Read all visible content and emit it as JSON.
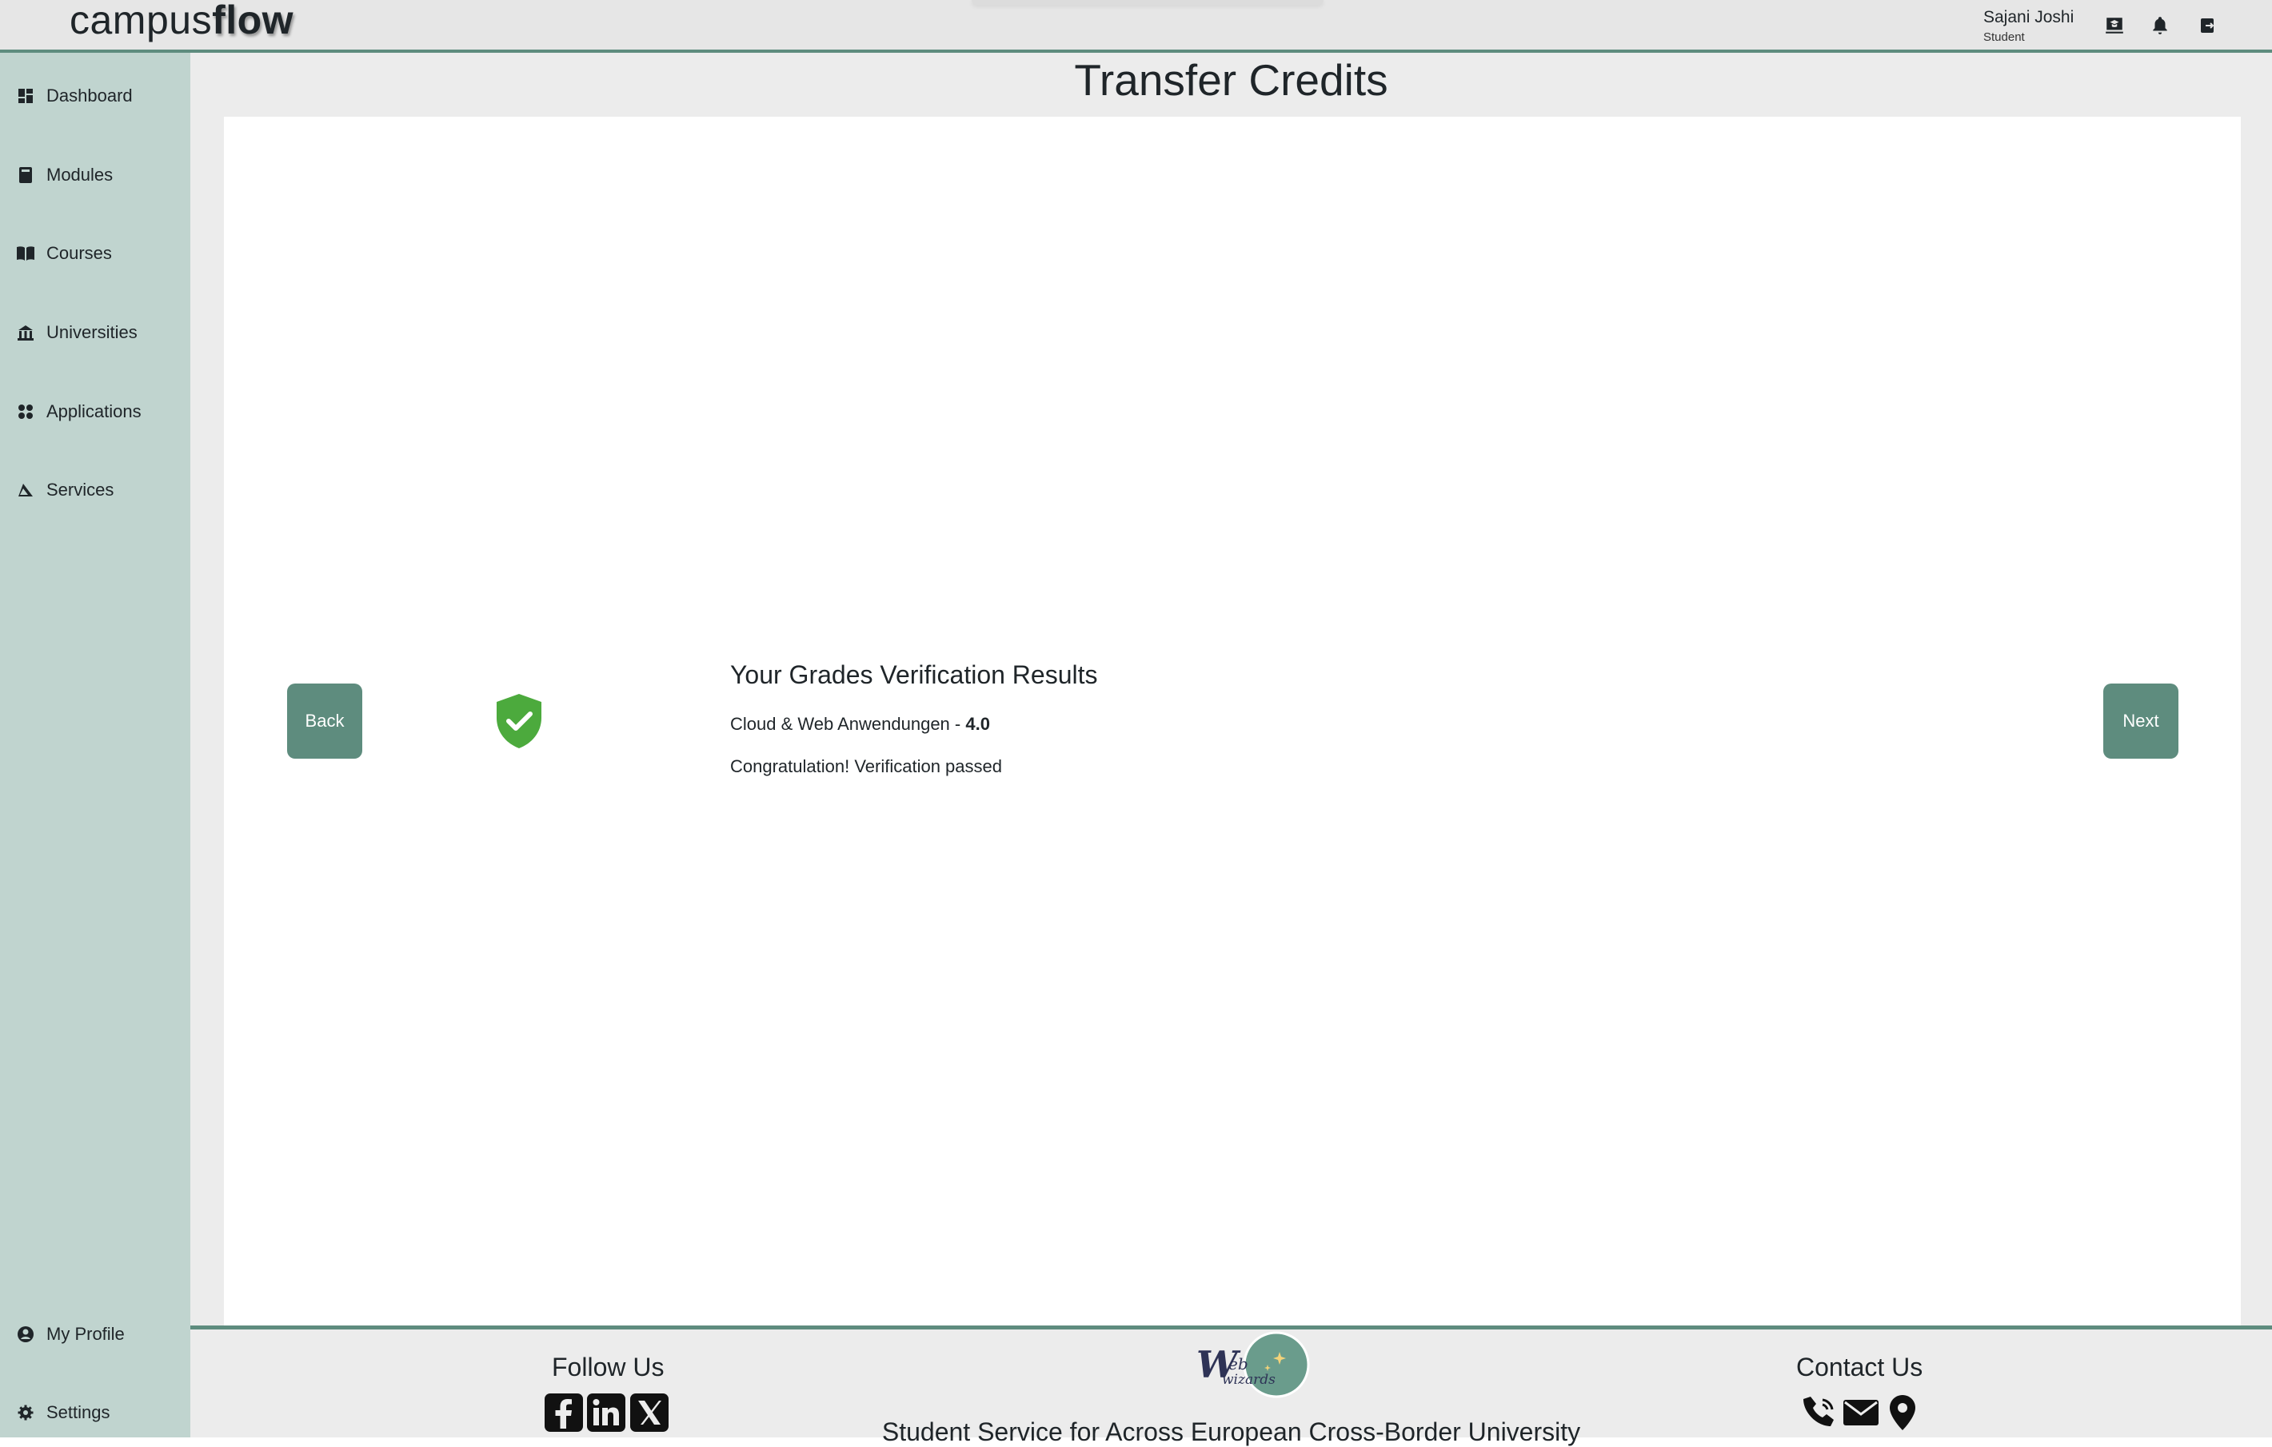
{
  "header": {
    "logo_light": "campus",
    "logo_bold": "flow",
    "user_name": "Sajani Joshi",
    "user_role": "Student",
    "icons": [
      "graduation-icon",
      "bell-icon",
      "logout-icon"
    ]
  },
  "sidebar": {
    "items": [
      {
        "label": "Dashboard",
        "icon": "dashboard-icon"
      },
      {
        "label": "Modules",
        "icon": "book-icon"
      },
      {
        "label": "Courses",
        "icon": "open-book-icon"
      },
      {
        "label": "Universities",
        "icon": "university-icon"
      },
      {
        "label": "Applications",
        "icon": "apps-icon"
      },
      {
        "label": "Services",
        "icon": "services-icon"
      }
    ],
    "bottom_items": [
      {
        "label": "My Profile",
        "icon": "profile-icon"
      },
      {
        "label": "Settings",
        "icon": "gear-icon"
      }
    ]
  },
  "main": {
    "title": "Transfer Credits",
    "back_label": "Back",
    "next_label": "Next",
    "result_title": "Your Grades Verification Results",
    "module_name": "Cloud & Web Anwendungen - ",
    "grade": "4.0",
    "message": "Congratulation! Verification passed"
  },
  "footer": {
    "follow_title": "Follow Us",
    "contact_title": "Contact Us",
    "brand_logo_text": "Web wizards",
    "tagline": "Student Service for Across European Cross-Border University"
  },
  "colors": {
    "accent": "#5e8c7e",
    "sidebar": "#c0d4cf",
    "success": "#4caa3d",
    "background": "#ececec"
  }
}
